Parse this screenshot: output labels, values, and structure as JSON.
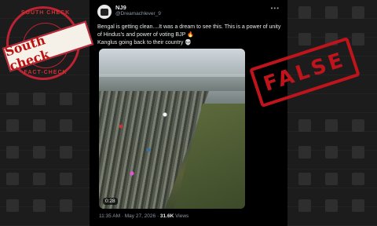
{
  "tweet": {
    "name": "NJ9",
    "handle": "@Dreamachlever_9",
    "text_line1": "Bengal is getting clean....It was a dream to see this. This is a power of unity of Hindus's and power of voting BJP 🔥",
    "text_line2": "Kanglus going back to their country 💀",
    "more_label": "•••",
    "video_duration": "0:28",
    "timestamp": "11:35 AM · May 27, 2026 · ",
    "views_count": "31.6K",
    "views_label": " Views"
  },
  "stamp": {
    "top_text": "SOUTH CHECK",
    "bottom_text": "FACT-CHECK",
    "banner_text": "South check"
  },
  "verdict": {
    "label": "FALSE",
    "color": "#c0141c"
  }
}
